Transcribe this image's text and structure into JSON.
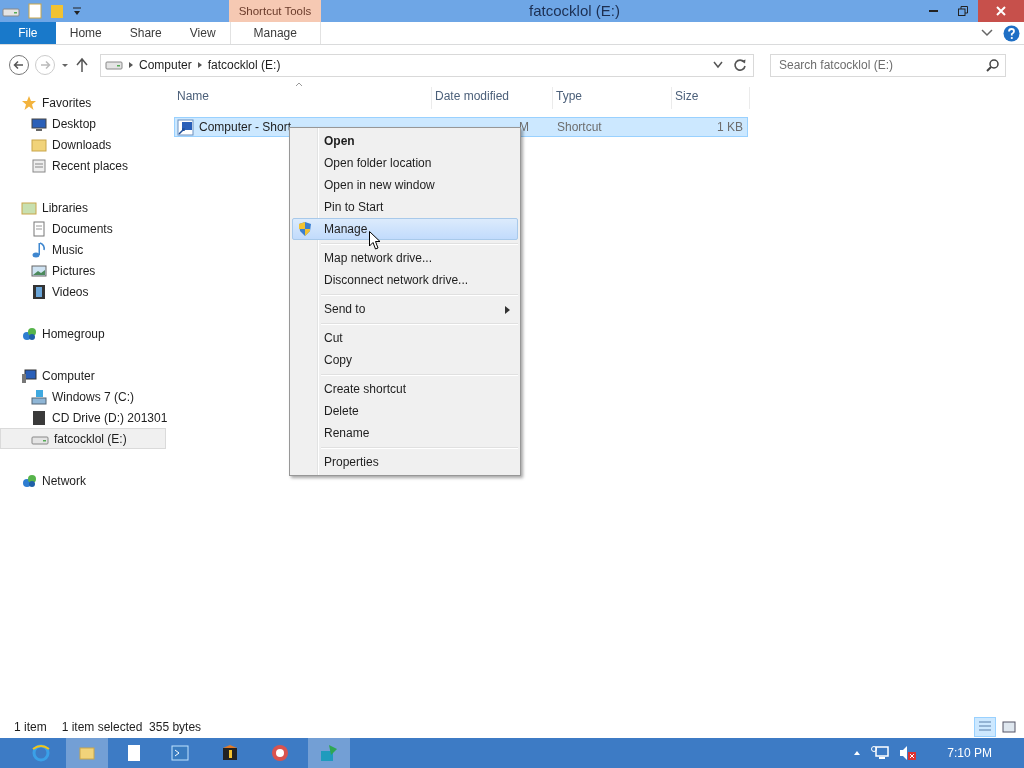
{
  "window": {
    "title": "fatcocklol (E:)",
    "context_tab_group": "Shortcut Tools"
  },
  "ribbon": {
    "tabs": [
      {
        "label": "File",
        "kind": "file"
      },
      {
        "label": "Home",
        "kind": "tab"
      },
      {
        "label": "Share",
        "kind": "tab"
      },
      {
        "label": "View",
        "kind": "tab"
      },
      {
        "label": "Manage",
        "kind": "context"
      }
    ]
  },
  "address": {
    "crumbs": [
      "Computer",
      "fatcocklol (E:)"
    ],
    "search": {
      "placeholder": "Search fatcocklol (E:)"
    }
  },
  "sidebar": {
    "groups": [
      {
        "label": "Favorites",
        "selected": false,
        "children": [
          {
            "label": "Desktop",
            "selected": false
          },
          {
            "label": "Downloads",
            "selected": false
          },
          {
            "label": "Recent places",
            "selected": false
          }
        ]
      },
      {
        "label": "Libraries",
        "selected": false,
        "children": [
          {
            "label": "Documents",
            "selected": false
          },
          {
            "label": "Music",
            "selected": false
          },
          {
            "label": "Pictures",
            "selected": false
          },
          {
            "label": "Videos",
            "selected": false
          }
        ]
      },
      {
        "label": "Homegroup",
        "selected": false
      },
      {
        "label": "Computer",
        "selected": false,
        "children": [
          {
            "label": "Windows 7 (C:)",
            "selected": false
          },
          {
            "label": "CD Drive (D:) 201301",
            "selected": false
          },
          {
            "label": "fatcocklol (E:)",
            "selected": true
          }
        ]
      },
      {
        "label": "Network",
        "selected": false
      }
    ]
  },
  "table": {
    "columns": [
      "Name",
      "Date modified",
      "Type",
      "Size"
    ],
    "rows": [
      {
        "name": "Computer - Short",
        "date_modified": "M",
        "type": "Shortcut",
        "size": "1 KB",
        "selected": true
      }
    ]
  },
  "context_menu": {
    "groups": [
      [
        {
          "label": "Open",
          "kind": "default",
          "selected": false
        },
        {
          "label": "Open folder location",
          "kind": "plain",
          "selected": false
        },
        {
          "label": "Open in new window",
          "kind": "plain",
          "selected": false
        },
        {
          "label": "Pin to Start",
          "kind": "plain",
          "selected": false
        },
        {
          "label": "Manage",
          "kind": "elevated",
          "selected": true
        }
      ],
      [
        {
          "label": "Map network drive...",
          "kind": "plain",
          "selected": false
        },
        {
          "label": "Disconnect network drive...",
          "kind": "plain",
          "selected": false
        }
      ],
      [
        {
          "label": "Send to",
          "kind": "submenu",
          "selected": false
        }
      ],
      [
        {
          "label": "Cut",
          "kind": "plain",
          "selected": false
        },
        {
          "label": "Copy",
          "kind": "plain",
          "selected": false
        }
      ],
      [
        {
          "label": "Create shortcut",
          "kind": "plain",
          "selected": false
        },
        {
          "label": "Delete",
          "kind": "plain",
          "selected": false
        },
        {
          "label": "Rename",
          "kind": "plain",
          "selected": false
        }
      ],
      [
        {
          "label": "Properties",
          "kind": "plain",
          "selected": false
        }
      ]
    ]
  },
  "status_bar": {
    "item_count": "1 item",
    "selection": "1 item selected  355 bytes",
    "views": [
      {
        "selected": true
      },
      {
        "selected": false
      }
    ]
  },
  "taskbar": {
    "apps": [
      {
        "active": false
      },
      {
        "active": true
      },
      {
        "active": false
      },
      {
        "active": false
      },
      {
        "active": false
      },
      {
        "active": false
      },
      {
        "active": true
      }
    ],
    "clock": "7:10 PM"
  }
}
